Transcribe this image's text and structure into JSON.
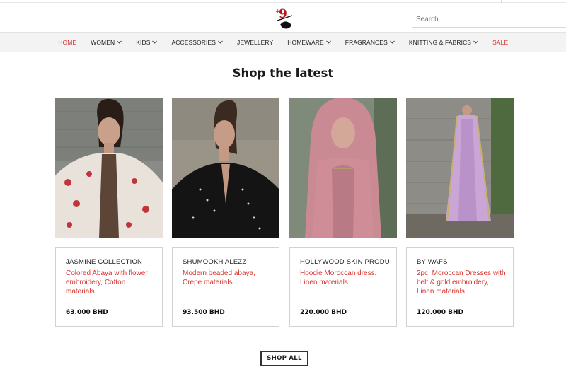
{
  "search": {
    "placeholder": "Search.."
  },
  "nav": [
    {
      "label": "HOME",
      "has_dropdown": false
    },
    {
      "label": "WOMEN",
      "has_dropdown": true
    },
    {
      "label": "KIDS",
      "has_dropdown": true
    },
    {
      "label": "ACCESSORIES",
      "has_dropdown": true
    },
    {
      "label": "JEWELLERY",
      "has_dropdown": false
    },
    {
      "label": "HOMEWARE",
      "has_dropdown": true
    },
    {
      "label": "FRAGRANCES",
      "has_dropdown": true
    },
    {
      "label": "KNITTING & FABRICS",
      "has_dropdown": true
    },
    {
      "label": "SALE!",
      "has_dropdown": false
    }
  ],
  "section": {
    "title": "Shop the latest"
  },
  "products": [
    {
      "brand": "JASMINE COLLECTION",
      "name": "Colored Abaya with flower embroidery, Cotton materials",
      "price": "63.000 BHD"
    },
    {
      "brand": "SHUMOOKH ALEZZ",
      "name": "Modern beaded abaya, Crepe materials",
      "price": "93.500 BHD"
    },
    {
      "brand": "HOLLYWOOD SKIN PRODU…",
      "name": "Hoodie Moroccan dress, Linen materials",
      "price": "220.000 BHD"
    },
    {
      "brand": "BY WAFS",
      "name": "2pc. Moroccan Dresses with belt & gold embroidery, Linen materials",
      "price": "120.000 BHD"
    }
  ],
  "shop_all": {
    "label": "SHOP ALL"
  },
  "colors": {
    "accent": "#d8322c",
    "nav_bg": "#f3f3f3",
    "border": "#d2d2d2",
    "text": "#222222"
  },
  "icons": {
    "logo": "brand-logo",
    "dropdown": "chevron-down-icon"
  }
}
